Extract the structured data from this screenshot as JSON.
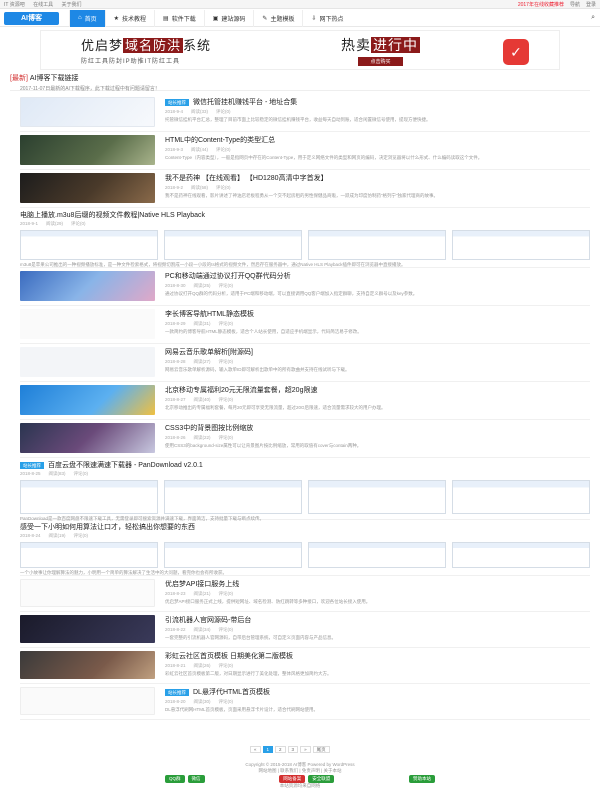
{
  "topbar": {
    "left": [
      "IT 资源吧",
      "在线工具",
      "关于我们"
    ],
    "right": [
      "2017年在线收藏推荐",
      "导航",
      "登录"
    ]
  },
  "nav": {
    "logo": "AI博客",
    "items": [
      {
        "icon": "⌂",
        "label": "首页"
      },
      {
        "icon": "★",
        "label": "技术教程"
      },
      {
        "icon": "▤",
        "label": "软件下载"
      },
      {
        "icon": "▣",
        "label": "建站源码"
      },
      {
        "icon": "✎",
        "label": "主题模板"
      },
      {
        "icon": "⇩",
        "label": "网下热点"
      }
    ],
    "search_icon": "⌕"
  },
  "banner": {
    "title_pre": "优启梦",
    "title_hl": "域名防洪",
    "title_post": "系统",
    "subtitle": "防红工具防封IP助推IT防红工具",
    "hot_pre": "热卖",
    "hot_hl": "进行中",
    "buy": "点击购买",
    "logo_glyph": "✓"
  },
  "notice": {
    "tag": "[最新]",
    "text": "AI博客下载链接",
    "sub": "2017-11-07日最新的AI下载程序，此下载过程中有问题请留言！"
  },
  "articles": [
    {
      "title": "微信托管挂机赚钱平台 - 地址合集",
      "badge": "站长推荐",
      "date": "2018-9-4",
      "views": "阅读(33)",
      "comments": "评论(0)",
      "excerpt": "托管微信挂机平台汇总，整理了目前市面上比较稳定的微信挂机赚钱平台，收益每天自动到账，适合闲置微信号使用，提现方便快捷。",
      "thumb": "linear-gradient(135deg,#dfe9f6,#f7f9fc)"
    },
    {
      "title": "HTML中的Content-Type的类型汇总",
      "date": "2018-9-3",
      "views": "阅读(44)",
      "comments": "评论(0)",
      "excerpt": "Content-Type（内容类型），一般是指网页中存在的Content-Type，用于定义网络文件的类型和网页的编码，决定浏览器将以什么形式、什么编码读取这个文件。",
      "thumb": "linear-gradient(135deg,#2b3f2f,#5a6d4a 60%,#a9b48c)"
    },
    {
      "title": "我不是药神 【在线观看】 【HD1280高清中字首发】",
      "date": "2018-9-2",
      "views": "阅读(58)",
      "comments": "评论(0)",
      "excerpt": "我不是药神在线观看，影片讲述了神油店老板程勇从一个交不起房租的男性保健品商贩，一跃成为印度仿制药“格列宁”独家代理商的故事。",
      "thumb": "linear-gradient(135deg,#1c1c1c,#4a3a2a 55%,#8a6a4a)"
    }
  ],
  "wide1": {
    "title": "电脑上播放.m3u8后缀的视频文件教程|Native HLS Playback",
    "date": "2018-9-1",
    "views": "阅读(29)",
    "comments": "评论(0)",
    "excerpt": "m3u8是苹果公司推出的一种视频播放标准，是一种文件检索格式，将视频切割成一小段一小段的ts格式的视频文件，然后存在服务器中，通过Native HLS Playback插件即可在浏览器中直接播放。"
  },
  "articles2": [
    {
      "title": "PC和移动端通过协议打开QQ群代码分析",
      "date": "2018-8-30",
      "views": "阅读(25)",
      "comments": "评论(0)",
      "excerpt": "通过协议打开QQ群的代码分析，适用于PC端和移动端，可以直接调用QQ客户端加入指定群聊，支持自定义群号以及key参数。",
      "thumb": "linear-gradient(135deg,#3a6bbf,#89b4e8 50%,#e0a8c8)"
    },
    {
      "title": "李长博客导航HTML静态模板",
      "date": "2018-8-29",
      "views": "阅读(31)",
      "comments": "评论(0)",
      "excerpt": "一款简约的博客导航HTML静态模板，适合个人站长使用，自适应手机端显示，代码简洁易于修改。",
      "thumb": "linear-gradient(135deg,#f4f4f4,#ffffff)"
    },
    {
      "title": "网易云音乐歌单解析[附源码]",
      "date": "2018-8-28",
      "views": "阅读(27)",
      "comments": "评论(0)",
      "excerpt": "网易云音乐歌单解析源码，输入歌单ID即可解析出歌单中的所有歌曲并支持在线试听与下载。",
      "thumb": "linear-gradient(135deg,#eef1f5,#fafafa)"
    },
    {
      "title": "北京移动专属福利20元无限流量套餐，超20g限速",
      "date": "2018-8-27",
      "views": "阅读(40)",
      "comments": "评论(0)",
      "excerpt": "北京移动推出的专属福利套餐，每月20元即可享受无限流量，超过20G后限速，适合流量需求较大的用户办理。",
      "thumb": "linear-gradient(135deg,#1e7fd8,#5cb0f0 60%,#f0c040)"
    },
    {
      "title": "CSS3中的背景图按比例缩放",
      "date": "2018-8-26",
      "views": "阅读(22)",
      "comments": "评论(0)",
      "excerpt": "使用CSS3的background-size属性可以让背景图片按比例缩放，常用的取值有cover与contain两种。",
      "thumb": "linear-gradient(135deg,#2a3550,#6a4a7a 50%,#c8c8e0)"
    }
  ],
  "wide2": {
    "badge": "站长推荐",
    "title": "百度云盘不限速满速下载器 - PanDownload v2.0.1",
    "date": "2018-8-25",
    "views": "阅读(83)",
    "comments": "评论(0)",
    "excerpt": "PanDownload是一款百度网盘不限速下载工具，无需登录即可搜索资源并满速下载，界面简洁，支持批量下载与断点续传。"
  },
  "wide3": {
    "title": "感受一下小明如何用算法让口才，轻松搞出你想要的东西",
    "date": "2018-8-24",
    "views": "阅读(19)",
    "comments": "评论(0)",
    "excerpt": "一个小故事让你理解算法的魅力，小明用一个简单的算法解决了生活中的大问题，看完你也会有所收获。"
  },
  "articles3": [
    {
      "title": "优启梦API接口服务上线",
      "date": "2018-8-23",
      "views": "阅读(21)",
      "comments": "评论(0)",
      "excerpt": "优启梦API接口服务正式上线，提供短网址、域名检测、防红跳转等多种接口，欢迎各位站长接入使用。",
      "thumb": "linear-gradient(135deg,#ffffff,#f3f3f3)"
    },
    {
      "title": "引流机器人官网源码-带后台",
      "date": "2018-8-22",
      "views": "阅读(34)",
      "comments": "评论(0)",
      "excerpt": "一套完整的引流机器人官网源码，自带后台管理系统，可自定义页面内容与产品信息。",
      "thumb": "linear-gradient(135deg,#1a1a2a,#3a3a5a)"
    },
    {
      "title": "彩虹云社区首页模板 日期美化第二版模板",
      "date": "2018-8-21",
      "views": "阅读(26)",
      "comments": "评论(0)",
      "excerpt": "彩虹云社区首页模板第二版，对日期显示进行了美化处理，整体风格更加简约大方。",
      "thumb": "linear-gradient(135deg,#3a3a3a,#7a5a4a 60%,#c0a080)"
    },
    {
      "title": "DL悬浮代HTML首页模板",
      "badge": "站长推荐",
      "date": "2018-8-20",
      "views": "阅读(30)",
      "comments": "评论(0)",
      "excerpt": "DL悬浮代刷网HTML首页模板，页面采用悬浮卡片设计，适合代刷网站使用。",
      "thumb": "linear-gradient(135deg,#ffffff,#f6f6f6)"
    }
  ],
  "pager": [
    "«",
    "1",
    "2",
    "3",
    "»",
    "尾页"
  ],
  "footer": {
    "line1": "Copyright © 2015-2018 AI博客 Powered by WordPress",
    "line2": "网站地图 | 联系我们 | 免责声明 | 关于本站",
    "badges_left": [
      "QQ群",
      "微信"
    ],
    "badges_mid": [
      "网站备案",
      "安全联盟"
    ],
    "badges_right": [
      "赞助本站"
    ],
    "line3": "本站资源均来自网络"
  },
  "colors": {
    "accent": "#1e88e5",
    "brand_red": "#8b1a1a",
    "badge": "#29a0e8"
  }
}
